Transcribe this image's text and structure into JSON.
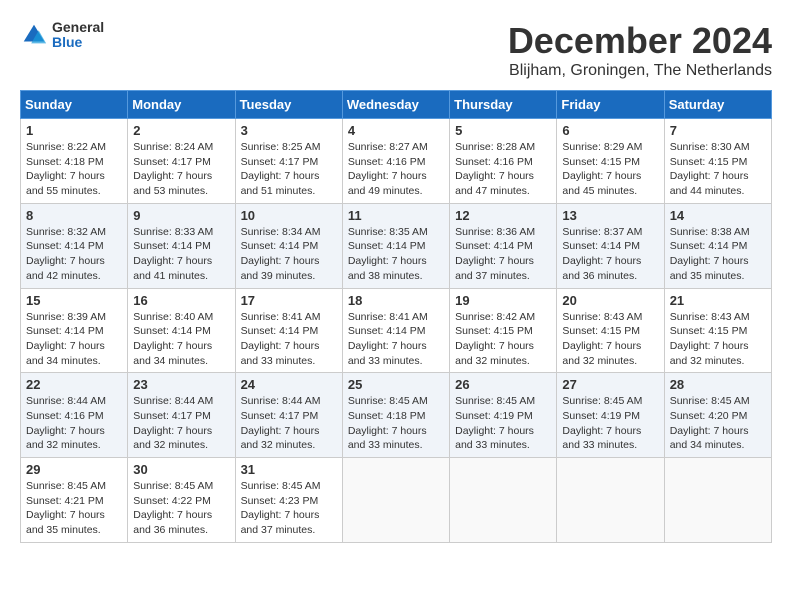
{
  "header": {
    "logo_general": "General",
    "logo_blue": "Blue",
    "title": "December 2024",
    "location": "Blijham, Groningen, The Netherlands"
  },
  "columns": [
    "Sunday",
    "Monday",
    "Tuesday",
    "Wednesday",
    "Thursday",
    "Friday",
    "Saturday"
  ],
  "weeks": [
    [
      {
        "day": "1",
        "info": "Sunrise: 8:22 AM\nSunset: 4:18 PM\nDaylight: 7 hours\nand 55 minutes."
      },
      {
        "day": "2",
        "info": "Sunrise: 8:24 AM\nSunset: 4:17 PM\nDaylight: 7 hours\nand 53 minutes."
      },
      {
        "day": "3",
        "info": "Sunrise: 8:25 AM\nSunset: 4:17 PM\nDaylight: 7 hours\nand 51 minutes."
      },
      {
        "day": "4",
        "info": "Sunrise: 8:27 AM\nSunset: 4:16 PM\nDaylight: 7 hours\nand 49 minutes."
      },
      {
        "day": "5",
        "info": "Sunrise: 8:28 AM\nSunset: 4:16 PM\nDaylight: 7 hours\nand 47 minutes."
      },
      {
        "day": "6",
        "info": "Sunrise: 8:29 AM\nSunset: 4:15 PM\nDaylight: 7 hours\nand 45 minutes."
      },
      {
        "day": "7",
        "info": "Sunrise: 8:30 AM\nSunset: 4:15 PM\nDaylight: 7 hours\nand 44 minutes."
      }
    ],
    [
      {
        "day": "8",
        "info": "Sunrise: 8:32 AM\nSunset: 4:14 PM\nDaylight: 7 hours\nand 42 minutes."
      },
      {
        "day": "9",
        "info": "Sunrise: 8:33 AM\nSunset: 4:14 PM\nDaylight: 7 hours\nand 41 minutes."
      },
      {
        "day": "10",
        "info": "Sunrise: 8:34 AM\nSunset: 4:14 PM\nDaylight: 7 hours\nand 39 minutes."
      },
      {
        "day": "11",
        "info": "Sunrise: 8:35 AM\nSunset: 4:14 PM\nDaylight: 7 hours\nand 38 minutes."
      },
      {
        "day": "12",
        "info": "Sunrise: 8:36 AM\nSunset: 4:14 PM\nDaylight: 7 hours\nand 37 minutes."
      },
      {
        "day": "13",
        "info": "Sunrise: 8:37 AM\nSunset: 4:14 PM\nDaylight: 7 hours\nand 36 minutes."
      },
      {
        "day": "14",
        "info": "Sunrise: 8:38 AM\nSunset: 4:14 PM\nDaylight: 7 hours\nand 35 minutes."
      }
    ],
    [
      {
        "day": "15",
        "info": "Sunrise: 8:39 AM\nSunset: 4:14 PM\nDaylight: 7 hours\nand 34 minutes."
      },
      {
        "day": "16",
        "info": "Sunrise: 8:40 AM\nSunset: 4:14 PM\nDaylight: 7 hours\nand 34 minutes."
      },
      {
        "day": "17",
        "info": "Sunrise: 8:41 AM\nSunset: 4:14 PM\nDaylight: 7 hours\nand 33 minutes."
      },
      {
        "day": "18",
        "info": "Sunrise: 8:41 AM\nSunset: 4:14 PM\nDaylight: 7 hours\nand 33 minutes."
      },
      {
        "day": "19",
        "info": "Sunrise: 8:42 AM\nSunset: 4:15 PM\nDaylight: 7 hours\nand 32 minutes."
      },
      {
        "day": "20",
        "info": "Sunrise: 8:43 AM\nSunset: 4:15 PM\nDaylight: 7 hours\nand 32 minutes."
      },
      {
        "day": "21",
        "info": "Sunrise: 8:43 AM\nSunset: 4:15 PM\nDaylight: 7 hours\nand 32 minutes."
      }
    ],
    [
      {
        "day": "22",
        "info": "Sunrise: 8:44 AM\nSunset: 4:16 PM\nDaylight: 7 hours\nand 32 minutes."
      },
      {
        "day": "23",
        "info": "Sunrise: 8:44 AM\nSunset: 4:17 PM\nDaylight: 7 hours\nand 32 minutes."
      },
      {
        "day": "24",
        "info": "Sunrise: 8:44 AM\nSunset: 4:17 PM\nDaylight: 7 hours\nand 32 minutes."
      },
      {
        "day": "25",
        "info": "Sunrise: 8:45 AM\nSunset: 4:18 PM\nDaylight: 7 hours\nand 33 minutes."
      },
      {
        "day": "26",
        "info": "Sunrise: 8:45 AM\nSunset: 4:19 PM\nDaylight: 7 hours\nand 33 minutes."
      },
      {
        "day": "27",
        "info": "Sunrise: 8:45 AM\nSunset: 4:19 PM\nDaylight: 7 hours\nand 33 minutes."
      },
      {
        "day": "28",
        "info": "Sunrise: 8:45 AM\nSunset: 4:20 PM\nDaylight: 7 hours\nand 34 minutes."
      }
    ],
    [
      {
        "day": "29",
        "info": "Sunrise: 8:45 AM\nSunset: 4:21 PM\nDaylight: 7 hours\nand 35 minutes."
      },
      {
        "day": "30",
        "info": "Sunrise: 8:45 AM\nSunset: 4:22 PM\nDaylight: 7 hours\nand 36 minutes."
      },
      {
        "day": "31",
        "info": "Sunrise: 8:45 AM\nSunset: 4:23 PM\nDaylight: 7 hours\nand 37 minutes."
      },
      {
        "day": "",
        "info": ""
      },
      {
        "day": "",
        "info": ""
      },
      {
        "day": "",
        "info": ""
      },
      {
        "day": "",
        "info": ""
      }
    ]
  ]
}
